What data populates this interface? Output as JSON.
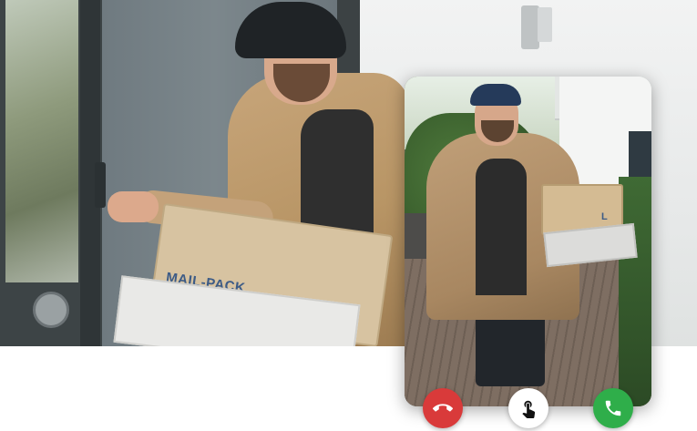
{
  "scene": {
    "box_label": "MAIL-PACK"
  },
  "preview": {
    "box_label": "L"
  },
  "actions": {
    "decline_icon": "phone-hangup-icon",
    "open_icon": "touch-tap-icon",
    "accept_icon": "phone-icon",
    "decline_color": "#d93a3a",
    "open_color": "#ffffff",
    "accept_color": "#2fae4a"
  }
}
